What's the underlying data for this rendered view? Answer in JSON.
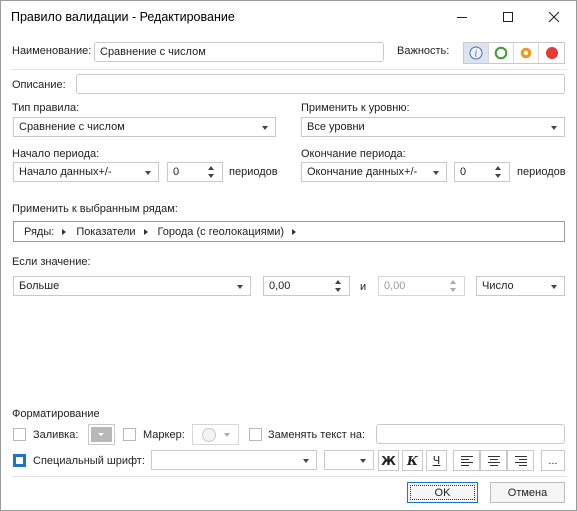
{
  "window": {
    "title": "Правило валидации - Редактирование",
    "controls": [
      "minimize-icon",
      "maximize-icon",
      "close-icon"
    ]
  },
  "name": {
    "label": "Наименование:",
    "value": "Сравнение с числом"
  },
  "importance": {
    "label": "Важность:",
    "options": [
      "info-icon",
      "green-circle-icon",
      "orange-circle-icon",
      "red-circle-icon"
    ],
    "selected": 0,
    "colors": {
      "green": "#3f9a3a",
      "orange": "#f09a1a",
      "red": "#e23b3b",
      "info": "#4a6fa5"
    }
  },
  "description": {
    "label": "Описание:",
    "value": ""
  },
  "rule_type": {
    "label": "Тип правила:",
    "value": "Сравнение с числом"
  },
  "apply_level": {
    "label": "Применить к уровню:",
    "value": "Все уровни"
  },
  "period_start": {
    "label": "Начало периода:",
    "mode": "Начало данных+/-",
    "count": "0",
    "unit": "периодов"
  },
  "period_end": {
    "label": "Окончание периода:",
    "mode": "Окончание данных+/-",
    "count": "0",
    "unit": "периодов"
  },
  "apply_rows": {
    "label": "Применить к выбранным рядам:",
    "crumbs": [
      "Ряды:",
      "Показатели",
      "Города (с геолокациями)"
    ]
  },
  "condition": {
    "label": "Если значение:",
    "operator": "Больше",
    "value1": "0,00",
    "and_label": "и",
    "value2": "0,00",
    "type": "Число"
  },
  "formatting": {
    "label": "Форматирование",
    "fill_label": "Заливка:",
    "fill_checked": false,
    "marker_label": "Маркер:",
    "marker_checked": false,
    "replace_label": "Заменять текст на:",
    "replace_checked": false,
    "replace_value": "",
    "font_label": "Специальный шрифт:",
    "font_checked": true,
    "font_family": "",
    "font_size": "",
    "bold": "Ж",
    "italic": "К",
    "underline": "Ч",
    "more": "...",
    "accent": "#1f74c9"
  },
  "buttons": {
    "ok": "OK",
    "cancel": "Отмена"
  }
}
